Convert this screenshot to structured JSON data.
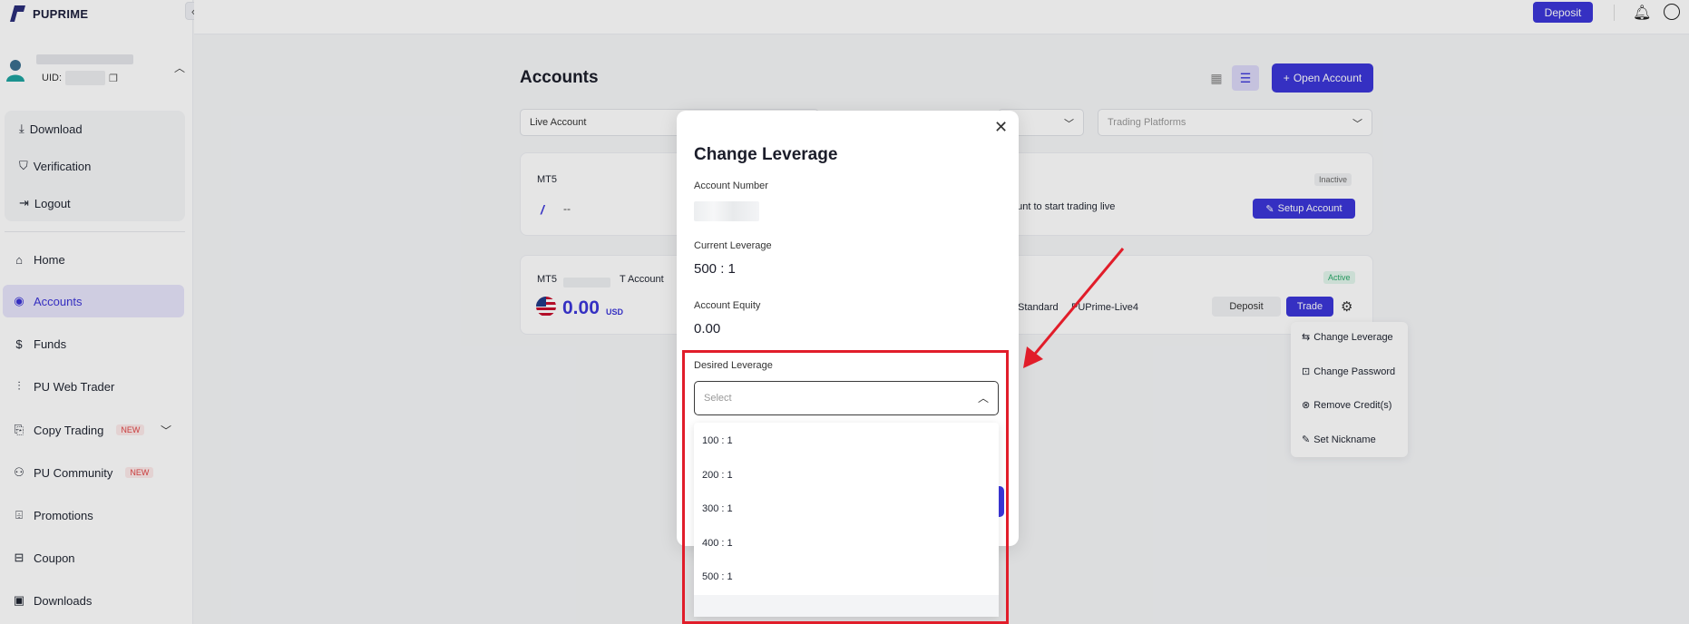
{
  "brand": {
    "logo_text": "PUPRIME"
  },
  "user": {
    "uid_label": "UID:"
  },
  "user_menu": [
    {
      "icon": "download-icon",
      "label": "Download"
    },
    {
      "icon": "shield-check-icon",
      "label": "Verification"
    },
    {
      "icon": "logout-icon",
      "label": "Logout"
    }
  ],
  "nav": [
    {
      "icon": "home-icon",
      "label": "Home"
    },
    {
      "icon": "user-circle-icon",
      "label": "Accounts",
      "active": true
    },
    {
      "icon": "dollar-icon",
      "label": "Funds"
    },
    {
      "icon": "chart-icon",
      "label": "PU Web Trader"
    },
    {
      "icon": "copy-icon",
      "label": "Copy Trading",
      "badge": "NEW"
    },
    {
      "icon": "community-icon",
      "label": "PU Community",
      "badge": "NEW"
    },
    {
      "icon": "gift-icon",
      "label": "Promotions"
    },
    {
      "icon": "coupon-icon",
      "label": "Coupon"
    },
    {
      "icon": "downloads-icon",
      "label": "Downloads"
    }
  ],
  "topbar": {
    "deposit_label": "Deposit"
  },
  "main": {
    "title": "Accounts",
    "open_account_label": "Open Account",
    "filters": {
      "account_type": "Live Account",
      "platforms": "Trading Platforms"
    },
    "card1": {
      "platform": "MT5",
      "status": "Inactive",
      "placeholder": "--",
      "trading_text": "ount to start trading live",
      "setup_label": "Setup Account"
    },
    "card2": {
      "platform": "MT5",
      "account_label": "T Account",
      "status": "Active",
      "balance": "0.00",
      "currency": "USD",
      "type": "Standard",
      "server": "PUPrime-Live4",
      "deposit_label": "Deposit",
      "trade_label": "Trade"
    },
    "action_menu": [
      {
        "icon": "swap-icon",
        "label": "Change Leverage"
      },
      {
        "icon": "lock-icon",
        "label": "Change Password"
      },
      {
        "icon": "remove-circle-icon",
        "label": "Remove Credit(s)"
      },
      {
        "icon": "pen-icon",
        "label": "Set Nickname"
      }
    ]
  },
  "modal": {
    "title": "Change Leverage",
    "account_number_label": "Account Number",
    "current_leverage_label": "Current Leverage",
    "current_leverage_value": "500 : 1",
    "equity_label": "Account Equity",
    "equity_value": "0.00",
    "desired_label": "Desired Leverage",
    "select_placeholder": "Select",
    "options": [
      "100 : 1",
      "200 : 1",
      "300 : 1",
      "400 : 1",
      "500 : 1"
    ]
  },
  "colors": {
    "accent": "#3b36d9",
    "highlight": "#e11d2a",
    "active_badge": "#2aa96a"
  }
}
